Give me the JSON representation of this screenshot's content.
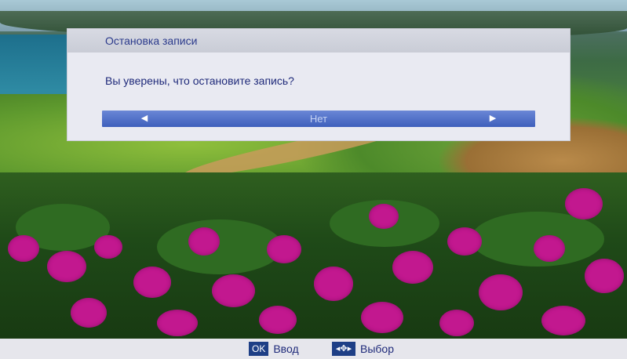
{
  "dialog": {
    "title": "Остановка записи",
    "message": "Вы уверены, что остановите запись?",
    "selector": {
      "value": "Нет",
      "left_arrow": "◀",
      "right_arrow": "▶"
    }
  },
  "hints": {
    "ok_key": "OK",
    "ok_label": "Ввод",
    "nav_key": "◂✥▸",
    "nav_label": "Выбор"
  },
  "colors": {
    "accent": "#3e5fbc",
    "dialog_bg": "#e9eaf2",
    "text": "#1f2a7a",
    "key_bg": "#1e3f86"
  }
}
